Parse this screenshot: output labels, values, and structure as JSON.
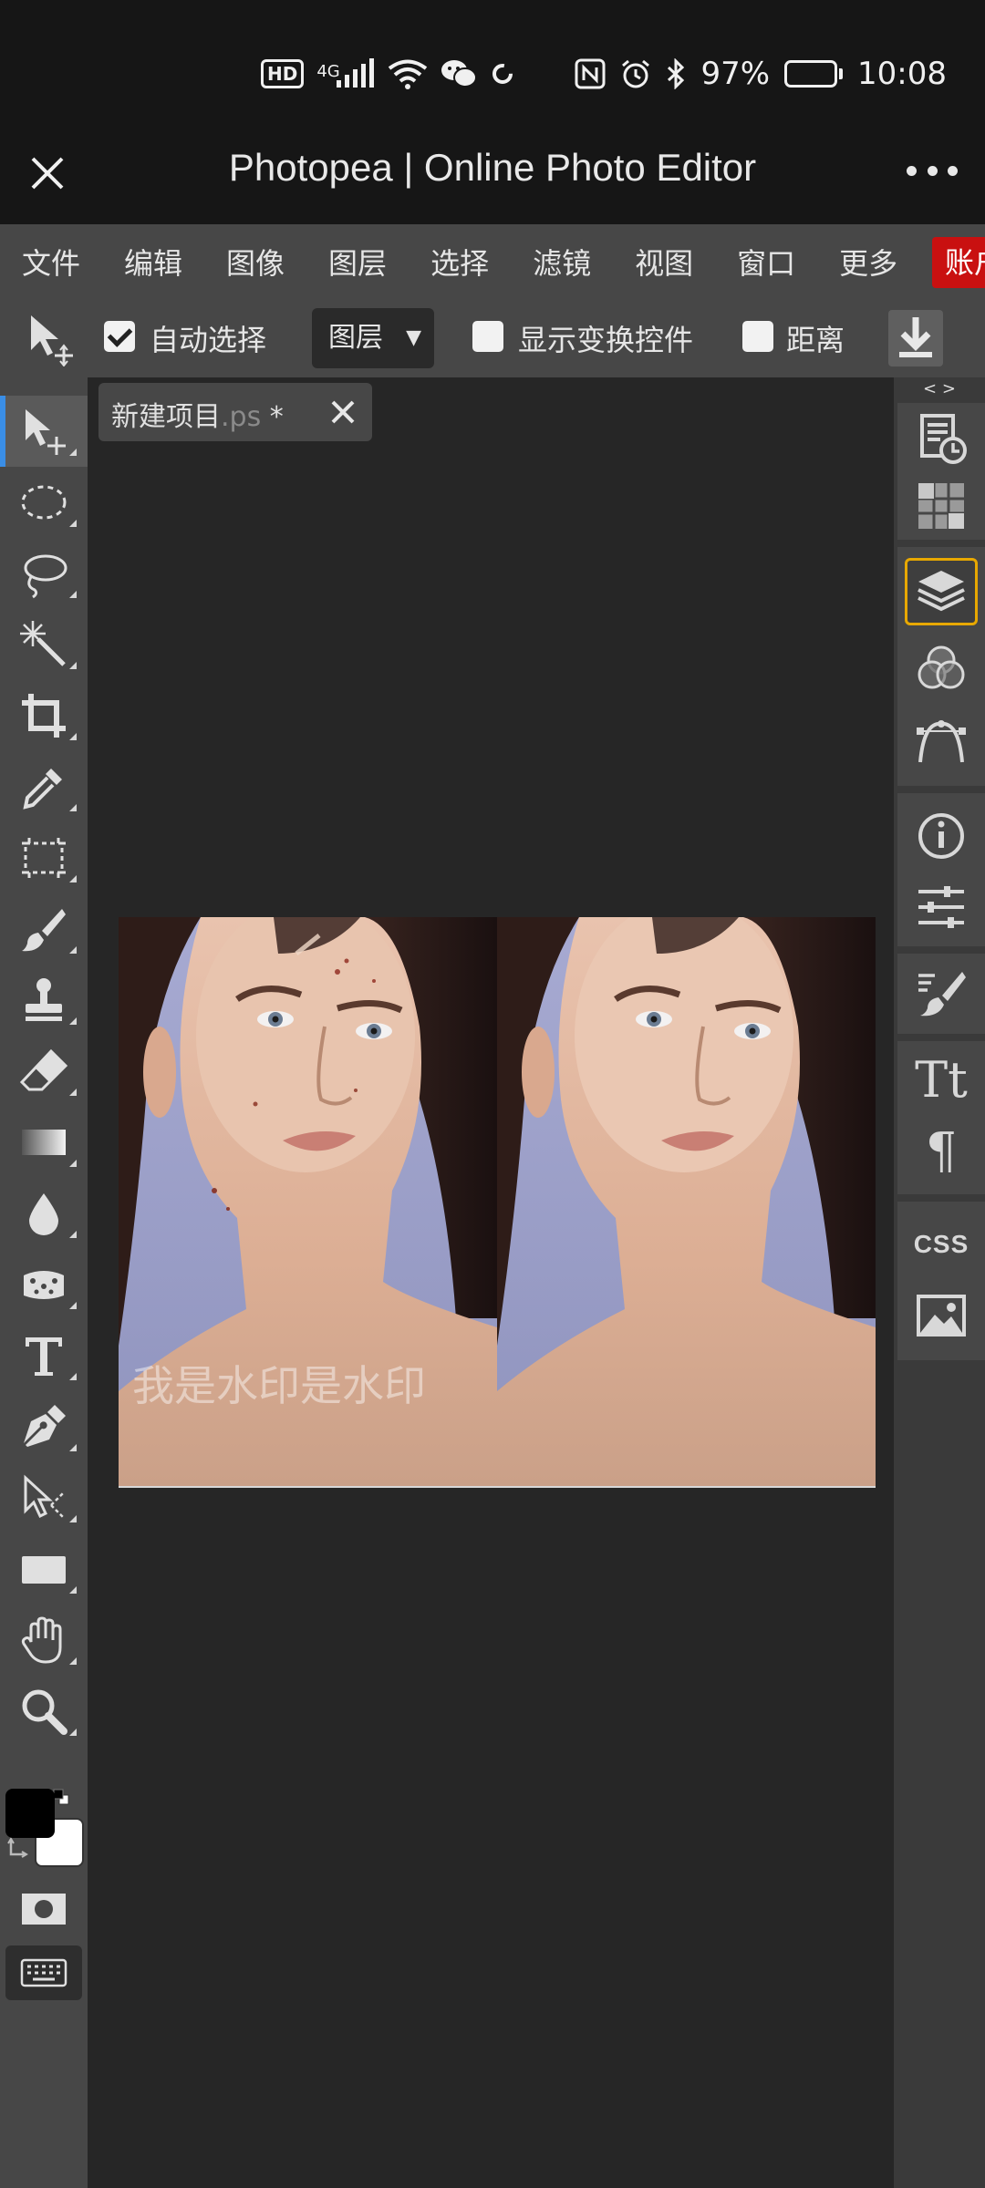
{
  "status_bar": {
    "hd": "HD",
    "network": "4G",
    "battery_percent": "97%",
    "battery_level": 0.97,
    "time": "10:08",
    "icons": [
      "hd-icon",
      "signal-icon",
      "wifi-icon",
      "wechat-icon",
      "sync-icon",
      "nfc-icon",
      "alarm-icon",
      "bluetooth-icon",
      "battery-icon"
    ]
  },
  "title_bar": {
    "title": "Photopea | Online Photo Editor"
  },
  "menu": {
    "items": [
      "文件",
      "编辑",
      "图像",
      "图层",
      "选择",
      "滤镜",
      "视图",
      "窗口",
      "更多"
    ],
    "account": "账户",
    "account_color": "#c91010"
  },
  "options": {
    "auto_select_label": "自动选择",
    "auto_select_checked": true,
    "layer_select_value": "图层",
    "show_transform_label": "显示变换控件",
    "show_transform_checked": false,
    "distance_label": "距离",
    "distance_checked": false
  },
  "document_tab": {
    "name": "新建项目",
    "extension": ".ps",
    "modified_mark": " *"
  },
  "canvas": {
    "watermark_text": "我是水印是水印"
  },
  "toolbox": {
    "tools": [
      "move-tool",
      "marquee-ellipse-tool",
      "lasso-tool",
      "magic-wand-tool",
      "crop-tool",
      "eyedropper-tool",
      "frame-select-tool",
      "brush-tool",
      "stamp-tool",
      "eraser-tool",
      "gradient-tool",
      "blur-drop-tool",
      "sponge-tool",
      "type-tool",
      "pen-tool",
      "path-select-tool",
      "rectangle-tool",
      "hand-tool",
      "zoom-tool"
    ],
    "active_tool": "move-tool",
    "foreground_color": "#000000",
    "background_color": "#ffffff"
  },
  "dock": {
    "collapse_label": "< >",
    "panels": [
      "history-icon",
      "swatches-icon",
      "layers-icon",
      "channels-icon",
      "paths-icon",
      "info-icon",
      "properties-icon",
      "brush-settings-icon",
      "character-icon",
      "paragraph-icon",
      "css-icon",
      "image-icon"
    ],
    "active_panel": "layers-icon",
    "character_glyph": "Tt",
    "paragraph_glyph": "¶",
    "css_label": "CSS",
    "accent_color": "#e8a800"
  }
}
